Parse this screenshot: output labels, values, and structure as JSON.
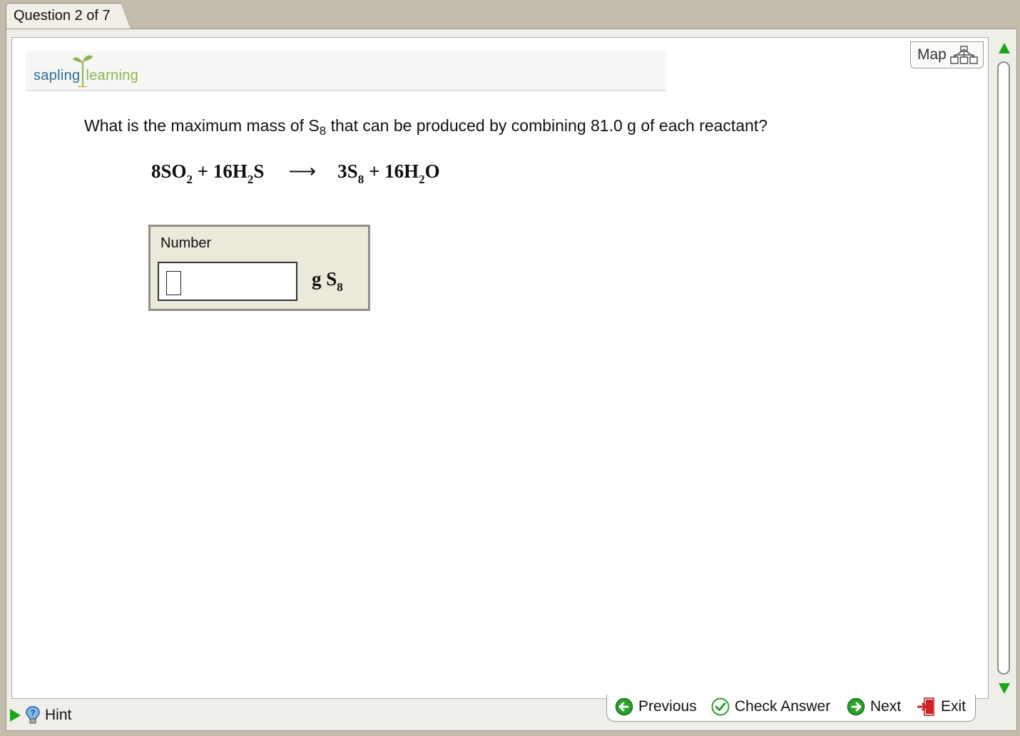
{
  "tab": {
    "label": "Question 2 of 7"
  },
  "logo": {
    "part1": "sapling",
    "part2": "learning"
  },
  "map": {
    "label": "Map"
  },
  "question": {
    "pre": "What is the maximum mass of S",
    "sub": "8",
    "post": " that can be produced by combining 81.0 g of each reactant?"
  },
  "equation": {
    "r1": "8SO",
    "r1_sub": "2",
    "plus1": " + 16H",
    "r2_sub": "2",
    "r2_end": "S",
    "arrow": "⟶",
    "p1": "3S",
    "p1_sub": "8",
    "plus2": " + 16H",
    "p2_sub": "2",
    "p2_end": "O"
  },
  "answer": {
    "label": "Number",
    "value": "",
    "unit": "g  S",
    "unit_sub": "8"
  },
  "nav": {
    "previous": "Previous",
    "check": "Check Answer",
    "next": "Next",
    "exit": "Exit"
  },
  "hint": {
    "label": "Hint"
  },
  "colors": {
    "green": "#1aa61a",
    "brand_blue": "#2c6c98",
    "brand_green": "#8db54c",
    "exit_red": "#d42020"
  }
}
